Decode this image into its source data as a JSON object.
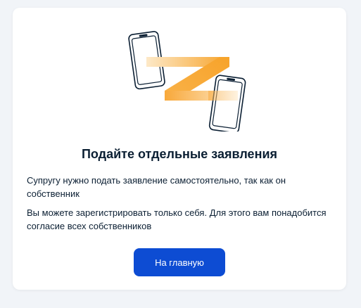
{
  "card": {
    "title": "Подайте отдельные заявления",
    "paragraph_1": "Супругу нужно подать заявление самостоятельно, так как он собственник",
    "paragraph_2": "Вы можете зарегистрировать только себя. Для этого вам понадобится согласие всех собственников",
    "button_label": "На главную"
  },
  "illustration": {
    "icon": "two-phones-exchange-illustration",
    "accent_color": "#f7a32a"
  },
  "colors": {
    "background": "#f1f4f8",
    "card": "#ffffff",
    "text": "#0b1f33",
    "primary_button": "#0d4cd3"
  }
}
